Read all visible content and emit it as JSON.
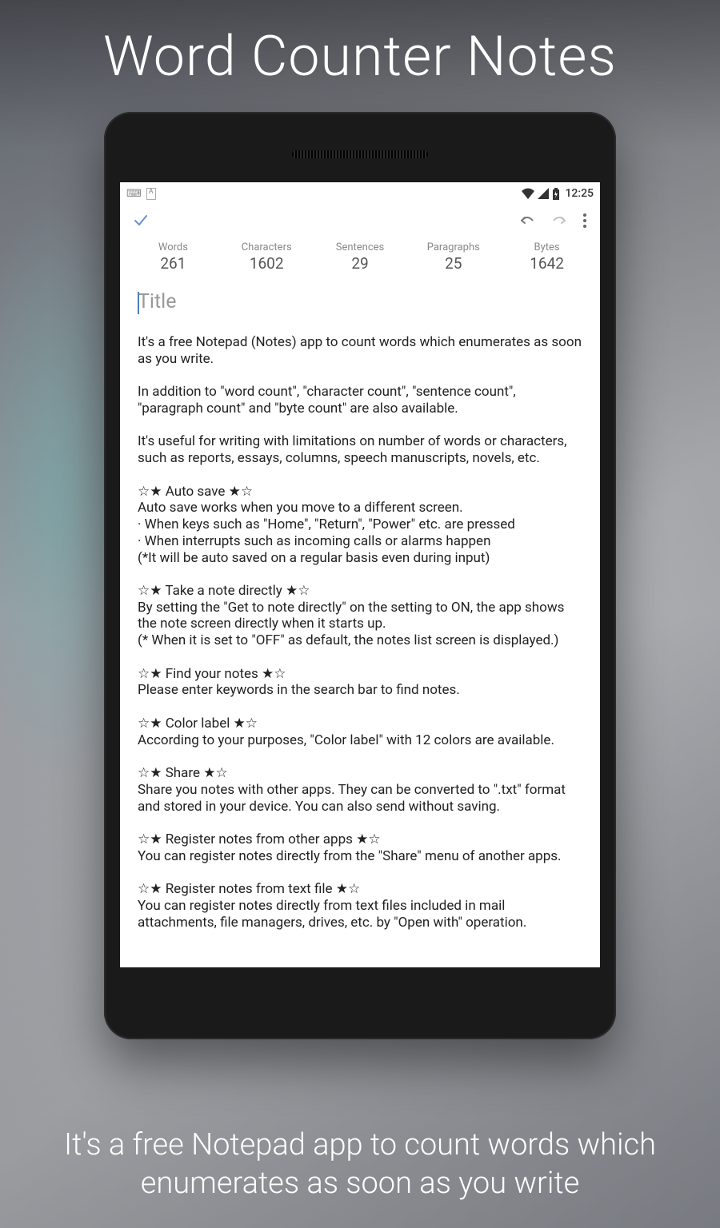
{
  "promo": {
    "title": "Word Counter Notes",
    "subtitle": "It's a free Notepad app to count words which enumerates as soon as you write"
  },
  "status": {
    "time": "12:25"
  },
  "counters": {
    "words": {
      "label": "Words",
      "value": "261"
    },
    "characters": {
      "label": "Characters",
      "value": "1602"
    },
    "sentences": {
      "label": "Sentences",
      "value": "29"
    },
    "paragraphs": {
      "label": "Paragraphs",
      "value": "25"
    },
    "bytes": {
      "label": "Bytes",
      "value": "1642"
    }
  },
  "editor": {
    "title_placeholder": "Title",
    "body": "It's a free Notepad (Notes) app to count words which enumerates as soon as you write.\n\nIn addition to \"word count\", \"character count\", \"sentence count\", \"paragraph count\" and \"byte count\" are also available.\n\nIt's useful for writing with limitations on number of words or characters, such as reports, essays, columns, speech manuscripts, novels, etc.\n\n☆★ Auto save ★☆\nAuto save works when you move to a different screen.\n· When keys such as \"Home\", \"Return\", \"Power\" etc. are pressed\n· When interrupts such as incoming calls or alarms happen\n(*It will be auto saved on a regular basis even during input)\n\n☆★ Take a note directly ★☆\nBy setting the \"Get to note directly\" on the setting to ON, the app shows the note screen directly when it starts up.\n(* When it is set to \"OFF\" as default, the notes list screen is displayed.)\n\n☆★ Find your notes ★☆\nPlease enter keywords in the search bar to find notes.\n\n☆★ Color label ★☆\nAccording to your purposes, \"Color label\" with 12 colors are available.\n\n☆★ Share ★☆\nShare you notes with other apps. They can be converted to \".txt\" format and stored in your device. You can also send without saving.\n\n☆★ Register notes from other apps ★☆\nYou can register notes directly from the \"Share\" menu of another apps.\n\n☆★ Register notes from text file ★☆\nYou can register notes directly from text files included in mail attachments, file managers, drives, etc. by \"Open with\" operation."
  }
}
